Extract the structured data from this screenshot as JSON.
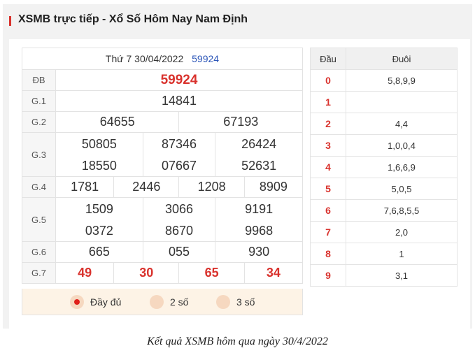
{
  "header": {
    "title": "XSMB trực tiếp - Xổ Số Hôm Nay Nam Định"
  },
  "result": {
    "date": "Thứ 7 30/04/2022",
    "code": "59924",
    "rows": {
      "db": {
        "label": "ĐB",
        "values": [
          "59924"
        ]
      },
      "g1": {
        "label": "G.1",
        "values": [
          "14841"
        ]
      },
      "g2": {
        "label": "G.2",
        "values": [
          "64655",
          "67193"
        ]
      },
      "g3": {
        "label": "G.3",
        "values": [
          "50805",
          "87346",
          "26424",
          "18550",
          "07667",
          "52631"
        ]
      },
      "g4": {
        "label": "G.4",
        "values": [
          "1781",
          "2446",
          "1208",
          "8909"
        ]
      },
      "g5": {
        "label": "G.5",
        "values": [
          "1509",
          "3066",
          "9191",
          "0372",
          "8670",
          "9968"
        ]
      },
      "g6": {
        "label": "G.6",
        "values": [
          "665",
          "055",
          "930"
        ]
      },
      "g7": {
        "label": "G.7",
        "values": [
          "49",
          "30",
          "65",
          "34"
        ]
      }
    }
  },
  "options": {
    "full": "Đầy đủ",
    "two": "2 số",
    "three": "3 số",
    "selected": "full"
  },
  "dau_duoi": {
    "head_label": "Đầu",
    "tail_label": "Đuôi",
    "rows": [
      {
        "head": "0",
        "tail": "5,8,9,9"
      },
      {
        "head": "1",
        "tail": ""
      },
      {
        "head": "2",
        "tail": "4,4"
      },
      {
        "head": "3",
        "tail": "1,0,0,4"
      },
      {
        "head": "4",
        "tail": "1,6,6,9"
      },
      {
        "head": "5",
        "tail": "5,0,5"
      },
      {
        "head": "6",
        "tail": "7,6,8,5,5"
      },
      {
        "head": "7",
        "tail": "2,0"
      },
      {
        "head": "8",
        "tail": "1"
      },
      {
        "head": "9",
        "tail": "3,1"
      }
    ]
  },
  "caption": "Kết quả XSMB hôm qua ngày 30/4/2022",
  "colors": {
    "accent": "#d9322d",
    "link": "#2b55b8",
    "option_bg": "#fdf3e6"
  }
}
